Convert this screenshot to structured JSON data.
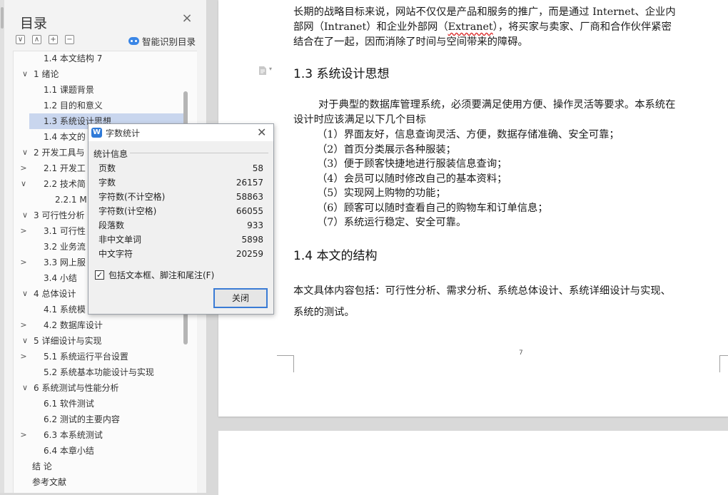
{
  "toc": {
    "title": "目录",
    "smart_label": "智能识别目录",
    "tools": [
      "∨",
      "∧",
      "+",
      "−"
    ],
    "items": [
      {
        "text": "1.4 本文结构 7",
        "arrow": "",
        "indent": 1
      },
      {
        "text": "1   绪论",
        "arrow": "∨",
        "indent": 0
      },
      {
        "text": "1.1   课题背景",
        "arrow": "",
        "indent": 1
      },
      {
        "text": "1.2   目的和意义",
        "arrow": "",
        "indent": 1
      },
      {
        "text": "1.3   系统设计思想",
        "arrow": "",
        "indent": 1,
        "selected": true
      },
      {
        "text": "1.4   本文的",
        "arrow": "",
        "indent": 1
      },
      {
        "text": "2   开发工具与",
        "arrow": "∨",
        "indent": 0
      },
      {
        "text": "2.1   开发工",
        "arrow": ">",
        "indent": 1
      },
      {
        "text": "2.2   技术简",
        "arrow": "∨",
        "indent": 1
      },
      {
        "text": "2.2.1   M",
        "arrow": "",
        "indent": 2
      },
      {
        "text": "3   可行性分析",
        "arrow": "∨",
        "indent": 0
      },
      {
        "text": "3.1   可行性",
        "arrow": ">",
        "indent": 1
      },
      {
        "text": "3.2   业务流",
        "arrow": "",
        "indent": 1
      },
      {
        "text": "3.3   网上服",
        "arrow": ">",
        "indent": 1
      },
      {
        "text": "3.4   小结",
        "arrow": "",
        "indent": 1
      },
      {
        "text": "4   总体设计",
        "arrow": "∨",
        "indent": 0
      },
      {
        "text": "4.1   系统模",
        "arrow": "",
        "indent": 1
      },
      {
        "text": "4.2   数据库设计",
        "arrow": ">",
        "indent": 1
      },
      {
        "text": "5   详细设计与实现",
        "arrow": "∨",
        "indent": 0
      },
      {
        "text": "5.1   系统运行平台设置",
        "arrow": ">",
        "indent": 1
      },
      {
        "text": "5.2   系统基本功能设计与实现",
        "arrow": "",
        "indent": 1
      },
      {
        "text": "6   系统测试与性能分析",
        "arrow": "∨",
        "indent": 0
      },
      {
        "text": "6.1   软件测试",
        "arrow": "",
        "indent": 1
      },
      {
        "text": "6.2   测试的主要内容",
        "arrow": "",
        "indent": 1
      },
      {
        "text": "6.3   本系统测试",
        "arrow": ">",
        "indent": 1
      },
      {
        "text": "6.4   本章小结",
        "arrow": "",
        "indent": 1
      },
      {
        "text": "结    论",
        "arrow": "",
        "indent": -1
      },
      {
        "text": "参考文献",
        "arrow": "",
        "indent": -1
      }
    ]
  },
  "word_count": {
    "title": "字数统计",
    "group_label": "统计信息",
    "rows": [
      {
        "label": "页数",
        "value": "58"
      },
      {
        "label": "字数",
        "value": "26157"
      },
      {
        "label": "字符数(不计空格)",
        "value": "58863"
      },
      {
        "label": "字符数(计空格)",
        "value": "66055"
      },
      {
        "label": "段落数",
        "value": "933"
      },
      {
        "label": "非中文单词",
        "value": "5898"
      },
      {
        "label": "中文字符",
        "value": "20259"
      }
    ],
    "include_label": "包括文本框、脚注和尾注(F)",
    "include_checked": true,
    "close_label": "关闭"
  },
  "document": {
    "para_top_line1": "长期的战略目标来说，网站不仅仅是产品和服务的推广，而是通过 Internet、企业内",
    "para_top_line2_a": "部网（Intranet）和企业外部网（",
    "para_top_line2_b": "Extranet",
    "para_top_line2_c": "），将买家与卖家、厂商和合作伙伴紧密",
    "para_top_line3": "结合在了一起，因而消除了时间与空间带来的障碍。",
    "heading_13": "1.3   系统设计思想",
    "intro_line1": "对于典型的数据库管理系统，必须要满足使用方便、操作灵活等要求。本系统在",
    "intro_line2": "设计时应该满足以下几个目标",
    "goals": [
      "（1）界面友好，信息查询灵活、方便，数据存储准确、安全可靠；",
      "（2）首页分类展示各种服装；",
      "（3）便于顾客快捷地进行服装信息查询；",
      "（4）会员可以随时修改自己的基本资料；",
      "（5）实现网上购物的功能；",
      "（6）顾客可以随时查看自己的购物车和订单信息；",
      "（7）系统运行稳定、安全可靠。"
    ],
    "heading_14": "1.4   本文的结构",
    "struct_line1": "本文具体内容包括：可行性分析、需求分析、系统总体设计、系统详细设计与实现、",
    "struct_line2": "系统的测试。",
    "page_number": "7"
  }
}
